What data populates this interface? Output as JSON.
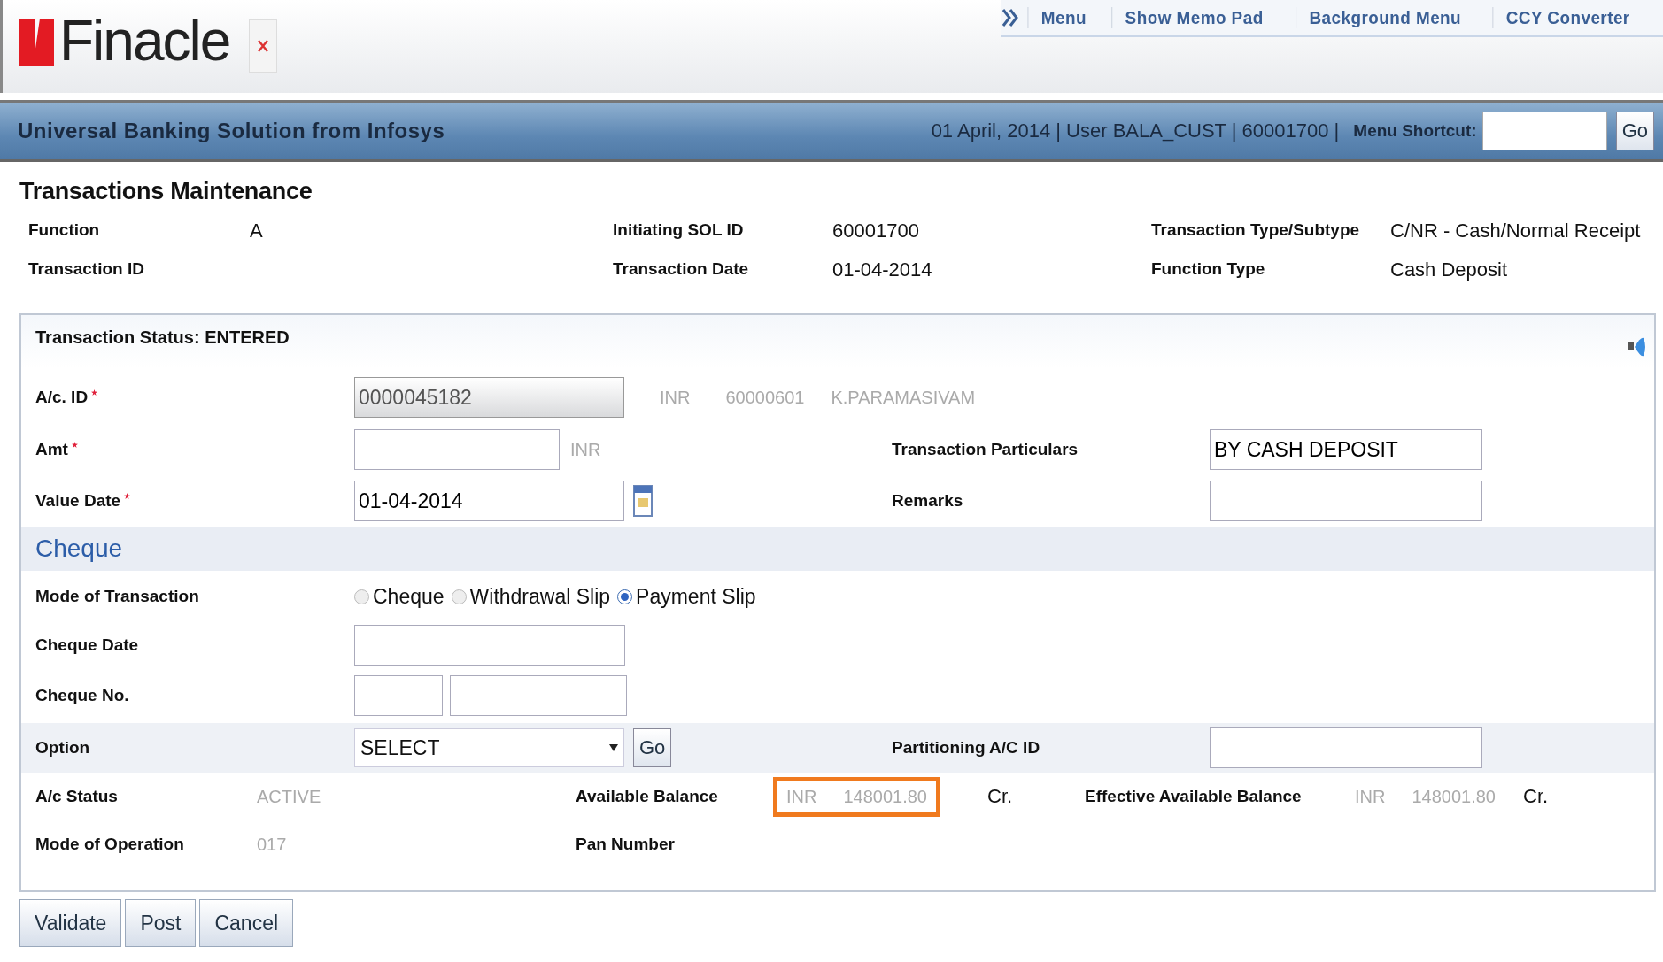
{
  "header": {
    "logo": "Finacle",
    "top_links": [
      "Menu",
      "Show Memo Pad",
      "Background Menu",
      "CCY Converter"
    ]
  },
  "banner": {
    "title": "Universal Banking Solution from Infosys",
    "session_info": "01 April, 2014 | User BALA_CUST | 60001700 |",
    "shortcut_label": "Menu Shortcut:",
    "go": "Go"
  },
  "page_title": "Transactions Maintenance",
  "info_fields": [
    {
      "label": "Function",
      "value": "A"
    },
    {
      "label": "Initiating SOL ID",
      "value": "60001700"
    },
    {
      "label": "Transaction Type/Subtype",
      "value": "C/NR - Cash/Normal Receipt"
    },
    {
      "label": "Transaction ID"
    },
    {
      "label": "Transaction Date",
      "value": "01-04-2014"
    },
    {
      "label": "Function Type",
      "value": "Cash Deposit"
    }
  ],
  "panel": {
    "status": "Transaction Status: ENTERED",
    "ac_id": {
      "label": "A/c. ID",
      "required": true,
      "value": "0000045182",
      "disabled": true,
      "currency": "INR",
      "sol": "60000601",
      "name": "K.PARAMASIVAM"
    },
    "amt": {
      "label": "Amt",
      "required": true,
      "currency": "INR"
    },
    "value_date": {
      "label": "Value Date",
      "required": true,
      "value": "01-04-2014"
    },
    "transaction_particulars": {
      "label": "Transaction Particulars",
      "value": "BY CASH DEPOSIT"
    },
    "remarks": {
      "label": "Remarks"
    },
    "section": "Cheque",
    "mode_of_transaction": {
      "label": "Mode of Transaction",
      "options": [
        {
          "label": "Cheque",
          "selected": false
        },
        {
          "label": "Withdrawal Slip",
          "selected": false
        },
        {
          "label": "Payment Slip",
          "selected": true
        }
      ]
    },
    "cheque_date": {
      "label": "Cheque Date"
    },
    "cheque_no": {
      "label": "Cheque No."
    },
    "option": {
      "label": "Option",
      "value": "SELECT",
      "go": "Go"
    },
    "partitioning": {
      "label": "Partitioning A/C ID"
    },
    "ac_status": {
      "label": "A/c Status",
      "value": "ACTIVE"
    },
    "available_balance": {
      "label": "Available Balance",
      "currency": "INR",
      "amount": "148001.80",
      "sign": "Cr.",
      "highlighted": true
    },
    "effective_available_balance": {
      "label": "Effective Available Balance",
      "currency": "INR",
      "amount": "148001.80",
      "sign": "Cr.",
      "highlighted": false
    },
    "mode_of_operation": {
      "label": "Mode of Operation",
      "value": "017"
    },
    "pan_number": {
      "label": "Pan Number"
    }
  },
  "buttons": [
    "Validate",
    "Post",
    "Cancel"
  ]
}
